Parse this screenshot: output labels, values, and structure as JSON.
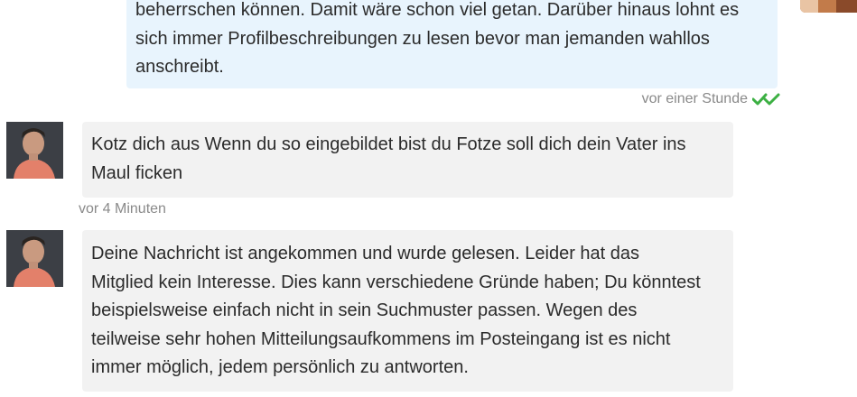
{
  "messages": [
    {
      "direction": "outgoing",
      "lines": [
        "beherrschen können. Damit wäre schon viel getan. Darüber hinaus lohnt es",
        "sich immer Profilbeschreibungen zu lesen bevor man jemanden wahllos",
        "anschreibt."
      ],
      "timestamp": "vor einer Stunde",
      "status_icon": "double-check-icon",
      "status_color": "#3cb043"
    },
    {
      "direction": "incoming",
      "lines": [
        "Kotz dich aus Wenn du so eingebildet bist du Fotze soll dich dein Vater ins",
        "Maul ficken"
      ],
      "timestamp": "vor 4 Minuten",
      "avatar_icon": "user-avatar"
    },
    {
      "direction": "incoming",
      "lines": [
        "Deine Nachricht ist angekommen und wurde gelesen. Leider hat das",
        "Mitglied kein Interesse. Dies kann verschiedene Gründe haben; Du könntest",
        "beispielsweise einfach nicht in sein Suchmuster passen. Wegen des",
        "teilweise sehr hohen Mitteilungsaufkommens im Posteingang ist es nicht",
        "immer möglich, jedem persönlich zu antworten."
      ],
      "avatar_icon": "user-avatar"
    }
  ],
  "colors": {
    "own_bubble": "#e8f4fd",
    "incoming_bubble": "#f2f2f2",
    "meta_text": "#8a8a8a"
  }
}
